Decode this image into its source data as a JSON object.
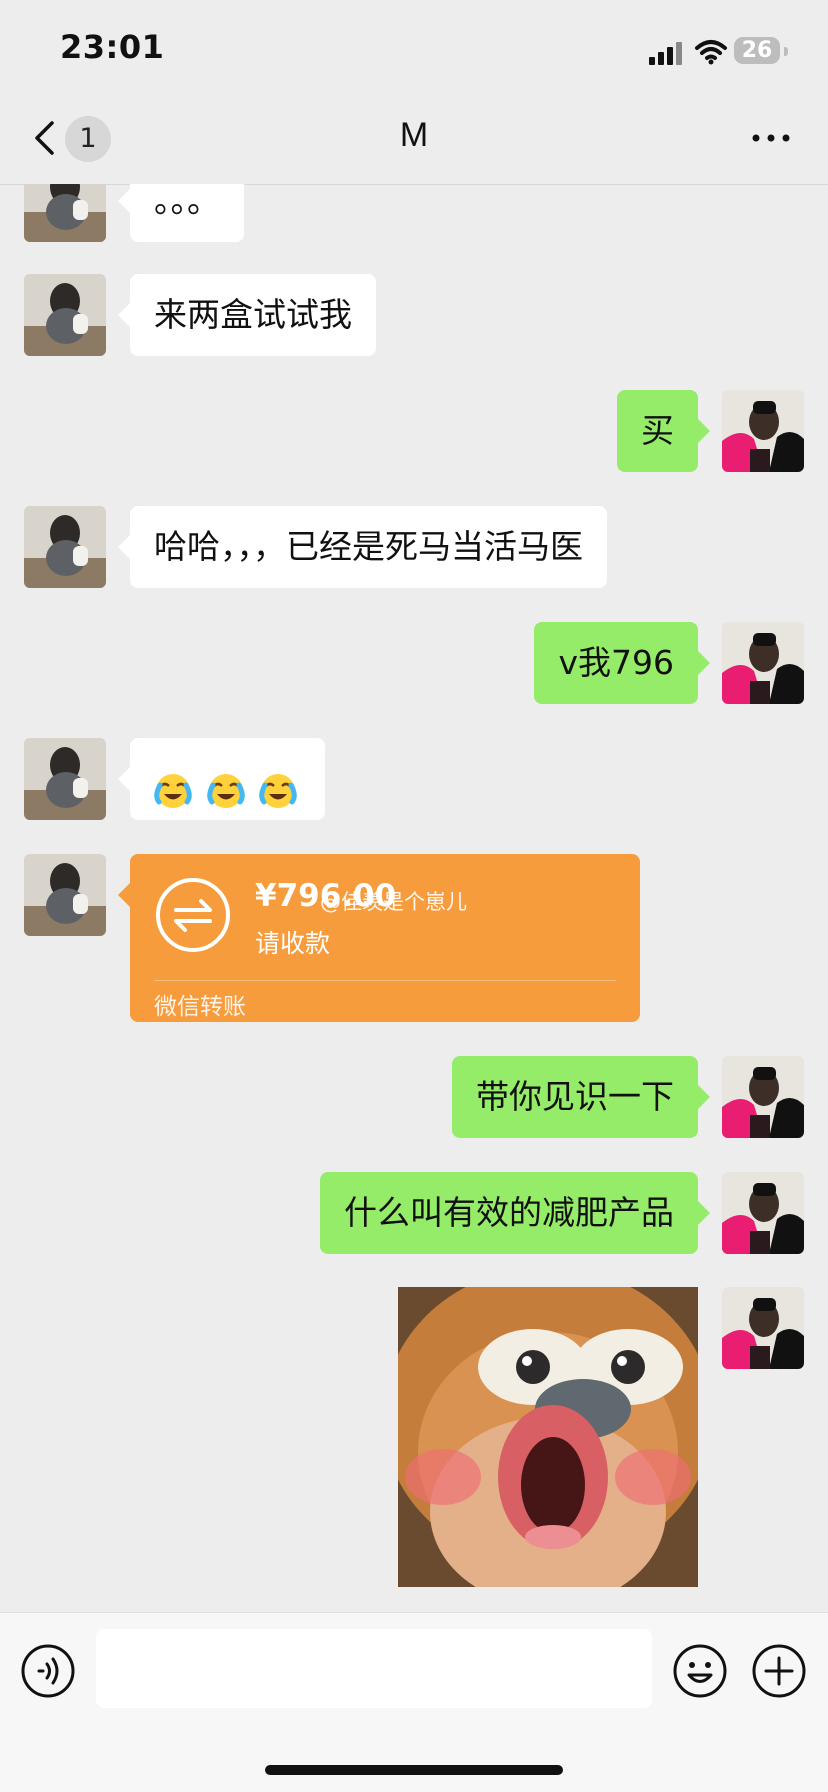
{
  "status": {
    "time": "23:01",
    "battery": "26"
  },
  "header": {
    "back_badge": "1",
    "title": "M"
  },
  "messages": [
    {
      "side": "left",
      "text": "。。。"
    },
    {
      "side": "left",
      "text": "来两盒试试我"
    },
    {
      "side": "right",
      "text": "买"
    },
    {
      "side": "left",
      "text": "哈哈，，，已经是死马当活马医"
    },
    {
      "side": "right",
      "text": "v我796"
    },
    {
      "side": "left",
      "type": "emoji",
      "emoji": [
        "laugh-crying-emoji",
        "laugh-crying-emoji",
        "laugh-crying-emoji"
      ]
    },
    {
      "side": "left",
      "type": "transfer",
      "amount": "¥796.00",
      "subtitle": "请收款",
      "footer": "微信转账",
      "watermark": "@佳羡是个崽儿"
    },
    {
      "side": "right",
      "text": "带你见识一下"
    },
    {
      "side": "right",
      "text": "什么叫有效的减肥产品"
    },
    {
      "side": "right",
      "type": "sticker",
      "sticker": "cartoon-bear-sticker"
    }
  ],
  "input": {
    "value": "",
    "placeholder": ""
  },
  "colors": {
    "background": "#ededed",
    "left_bubble": "#ffffff",
    "right_bubble": "#95ec69",
    "transfer_card": "#f79c3c"
  }
}
